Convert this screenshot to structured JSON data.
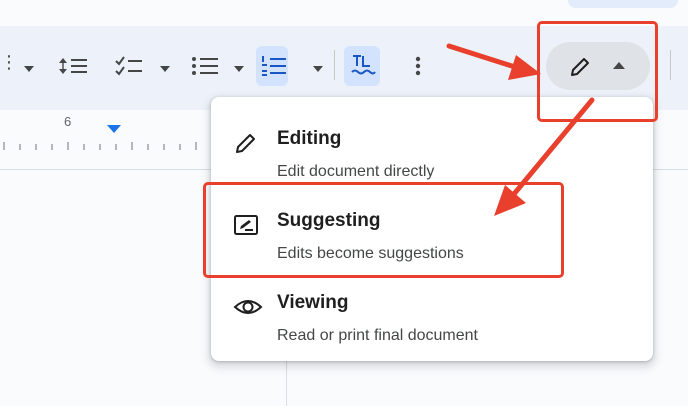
{
  "ruler": {
    "label": "6"
  },
  "toolbar": {
    "icons": {
      "line_spacing": "line-spacing-icon",
      "checklist": "checklist-icon",
      "bulleted_list": "bulleted-list-icon",
      "numbered_list": "numbered-list-icon",
      "spellcheck": "spellcheck-icon",
      "more": "more-vert-icon",
      "mode": "pencil-icon"
    }
  },
  "mode_menu": {
    "items": [
      {
        "title": "Editing",
        "description": "Edit document directly",
        "icon": "pencil-icon"
      },
      {
        "title": "Suggesting",
        "description": "Edits become suggestions",
        "icon": "suggest-edit-icon"
      },
      {
        "title": "Viewing",
        "description": "Read or print final document",
        "icon": "eye-icon"
      }
    ]
  },
  "colors": {
    "toolbar_bg": "#edf2fa",
    "selected_bg": "#d3e3fd",
    "annotation_red": "#e8402c",
    "ruler_marker": "#1a73e8"
  }
}
